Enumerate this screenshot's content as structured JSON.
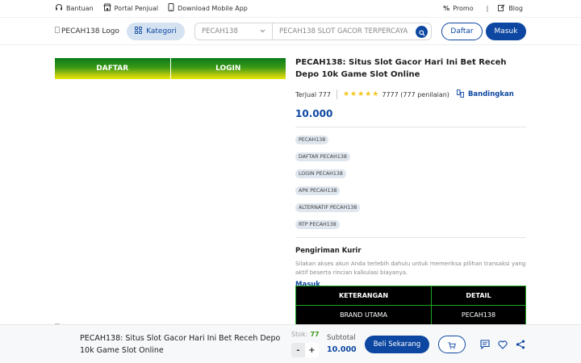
{
  "topbar": {
    "bantuan": "Bantuan",
    "portal_penjual": "Portal Penjual",
    "download_app": "Download Mobile App",
    "promo": "Promo",
    "separator": "|",
    "blog": "Blog"
  },
  "header": {
    "logo_alt": "PECAH138 Logo",
    "kategori": "Kategori",
    "select_value": "PECAH138",
    "search_placeholder": "PECAH138 SLOT GACOR TERPERCAYA",
    "daftar": "Daftar",
    "masuk": "Masuk"
  },
  "banner": {
    "left": "DAFTAR",
    "right": "LOGIN"
  },
  "product": {
    "title": "PECAH138: Situs Slot Gacor Hari Ini Bet Receh Depo 10k Game Slot Online",
    "sold": "Terjual 777",
    "rating_stars": 5,
    "rating_text": "7777 (777 penilaian)",
    "compare": "Bandingkan",
    "price": "10.000",
    "tags": [
      "PECAH138",
      "DAFTAR PECAH138",
      "LOGIN PECAH138",
      "APK PECAH138",
      "ALTERNATIF PECAH138",
      "RTP PECAH138"
    ]
  },
  "shipping": {
    "title": "Pengiriman Kurir",
    "desc": "Silakan akses akun Anda terlebih dahulu untuk memeriksa pilihan transaksi yang aktif beserta rincian kalkulasi biayanya.",
    "login_link": "Masuk"
  },
  "detail_table": {
    "headers": [
      "KETERANGAN",
      "DETAIL"
    ],
    "rows": [
      [
        "BRAND UTAMA",
        "PECAH138"
      ]
    ]
  },
  "bottom": {
    "title": "PECAH138: Situs Slot Gacor Hari Ini Bet Receh Depo 10k Game Slot Online",
    "stok_label": "Stok:",
    "stok_value": "77",
    "minus": "-",
    "plus": "+",
    "subtotal_label": "Subtotal",
    "subtotal_value": "10.000",
    "buy": "Beli Sekarang"
  },
  "colors": {
    "primary": "#0d47a1",
    "accent_green": "#1fa61f",
    "star": "#f5c518"
  },
  "icons": {
    "bantuan": "headset-icon",
    "portal": "store-icon",
    "download": "phone-icon",
    "promo": "percent-icon",
    "blog": "edit-icon",
    "kategori": "grid-icon",
    "search": "search-icon",
    "compare": "compare-icon",
    "cart": "cart-icon",
    "chat": "chat-icon",
    "wishlist": "heart-icon",
    "share": "share-icon"
  }
}
